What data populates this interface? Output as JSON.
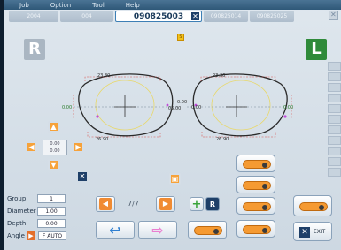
{
  "menu": [
    "Job",
    "Option",
    "Tool",
    "Help"
  ],
  "tabs": {
    "inactive_left": [
      "2004",
      "004"
    ],
    "active": "090825003",
    "inactive_right": [
      "090825014",
      "090825025"
    ]
  },
  "selection_marker": "S",
  "sides": {
    "right": "R",
    "left": "L"
  },
  "measurements": {
    "top_left": "23.30",
    "top_right": "23.30",
    "bottom_left": "26.90",
    "bottom_right": "26.90",
    "bridge_top": "0.00",
    "bridge_bottom": "05.00",
    "side_left": "0.00",
    "side_right": "0.00",
    "inner_left": "0.00"
  },
  "dpad": {
    "center_line1": "0.00",
    "center_line2": "0.00"
  },
  "params": {
    "group_label": "Group",
    "group_value": "1",
    "diameter_label": "Diameter",
    "diameter_value": "1.00",
    "depth_label": "Depth",
    "depth_value": "0.00",
    "angle_label": "Angle",
    "angle_value": "F AUTO"
  },
  "pager": "7/7",
  "exit_label": "EXIT",
  "colors": {
    "accent_orange": "#f08b33",
    "dark_blue": "#1e3f68",
    "green_side": "#2f8a3a"
  }
}
